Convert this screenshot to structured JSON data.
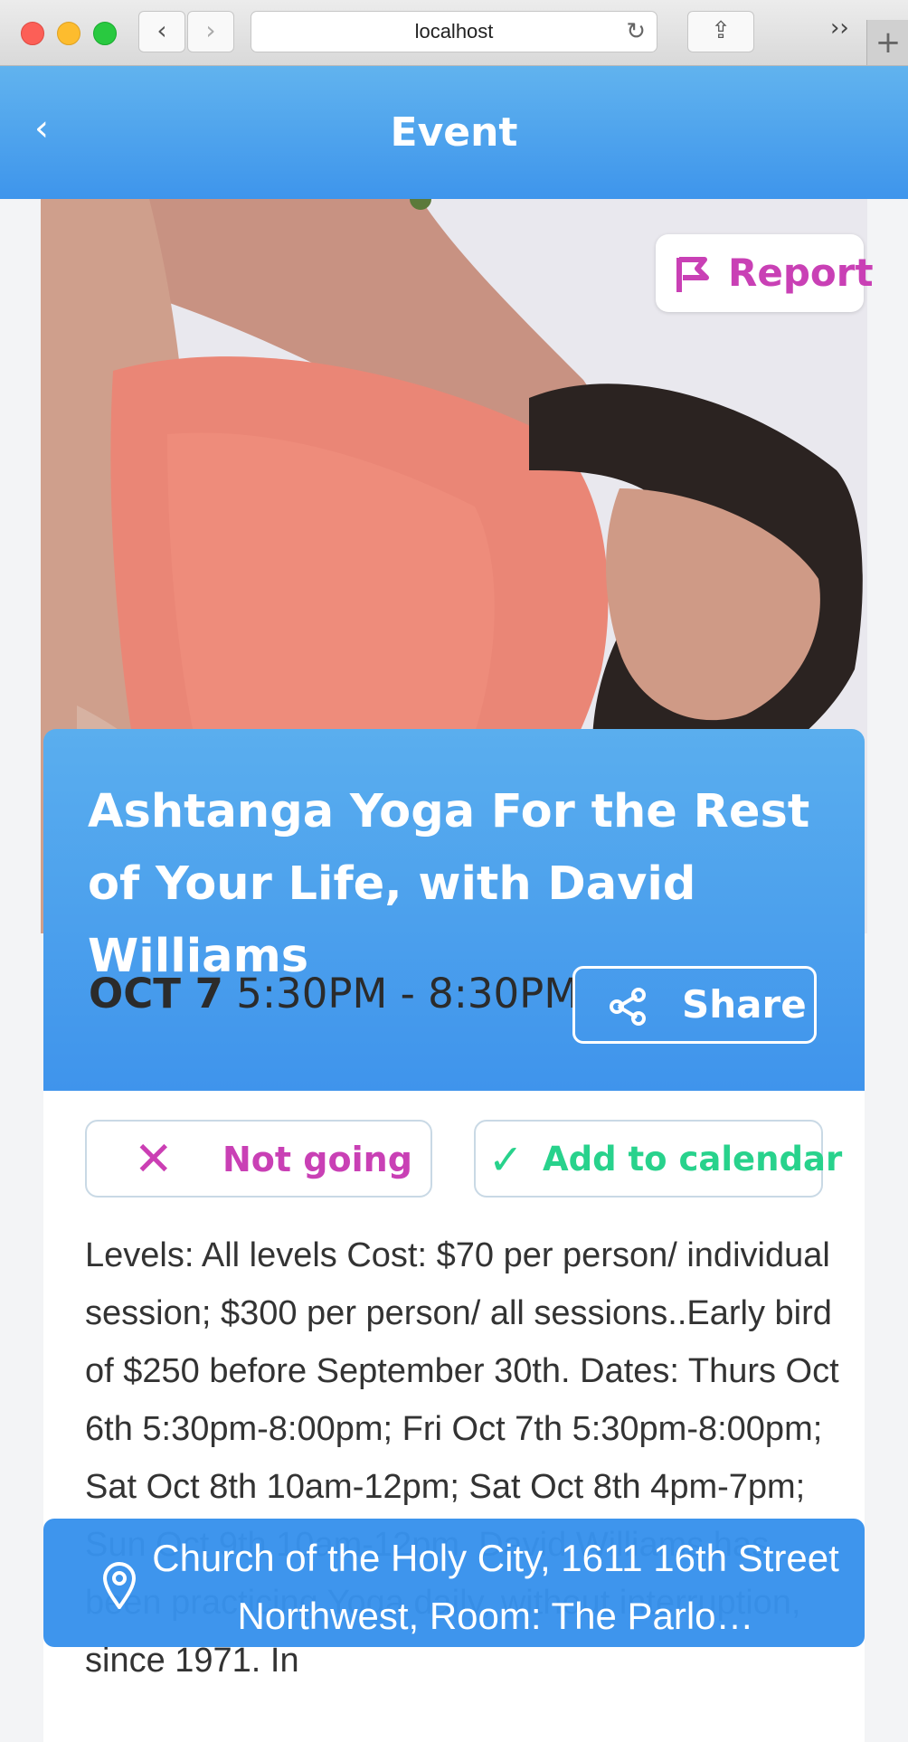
{
  "browser": {
    "url": "localhost",
    "back_glyph": "‹",
    "forward_glyph": "›",
    "reload_glyph": "↻",
    "share_glyph": "⇪",
    "overflow_glyph": "››",
    "newtab_glyph": "+"
  },
  "header": {
    "back_glyph": "‹",
    "title": "Event"
  },
  "hero": {
    "report_label": "Report"
  },
  "event": {
    "title": "Ashtanga Yoga For the Rest of Your Life, with David Williams",
    "date_day": "OCT 7",
    "date_time": "5:30PM - 8:30PM",
    "share_label": "Share"
  },
  "rsvp": {
    "not_going_glyph": "✕",
    "not_going_label": "Not going",
    "add_calendar_glyph": "✓",
    "add_calendar_label": "Add to calendar"
  },
  "description": "Levels: All levels Cost: $70 per person/ individual session; $300 per person/ all sessions..Early bird of $250 before September 30th. Dates: Thurs Oct 6th 5:30pm-8:00pm; Fri Oct 7th 5:30pm-8:00pm; Sat Oct 8th 10am-12pm; Sat Oct 8th 4pm-7pm; Sun Oct 9th 10am-12pm. David Williams has been practicing Yoga daily, without interruption, since 1971. In",
  "location": {
    "text": "Church of the Holy City, 1611 16th Street Northwest, Room: The Parlo…"
  },
  "colors": {
    "header_gradient_top": "#61b3ee",
    "header_gradient_bottom": "#3e95ec",
    "report_magenta": "#c940b5",
    "calendar_green": "#28d28c"
  },
  "icons": {
    "report": "flag-icon",
    "share": "share-icon",
    "not_going": "close-icon",
    "add_calendar": "check-icon",
    "location": "location-pin-icon"
  }
}
